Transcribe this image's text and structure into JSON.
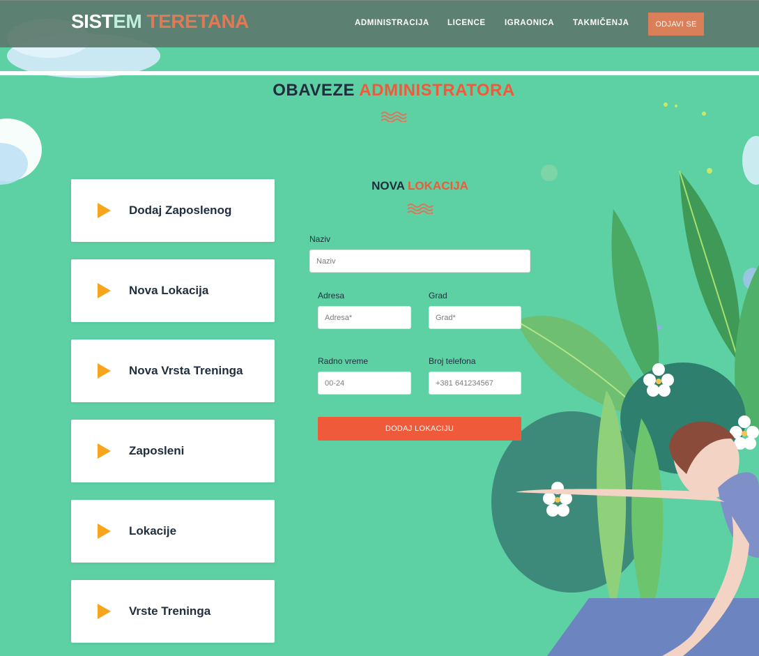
{
  "header": {
    "logo_part1": "SIST",
    "logo_part1b": "EM",
    "logo_part2": "TERETANA",
    "nav": [
      "ADMINISTRACIJA",
      "LICENCE",
      "IGRAONICA",
      "TAKMIČENJA"
    ],
    "logout_label": "ODJAVI SE"
  },
  "page_title": {
    "part1": "OBAVEZE",
    "part2": "ADMINISTRATORA"
  },
  "side_menu": [
    "Dodaj Zaposlenog",
    "Nova Lokacija",
    "Nova Vrsta Treninga",
    "Zaposleni",
    "Lokacije",
    "Vrste Treninga"
  ],
  "form": {
    "title_part1": "NOVA",
    "title_part2": "LOKACIJA",
    "naziv_label": "Naziv",
    "naziv_placeholder": "Naziv",
    "adresa_label": "Adresa",
    "adresa_placeholder": "Adresa*",
    "grad_label": "Grad",
    "grad_placeholder": "Grad*",
    "radno_label": "Radno vreme",
    "radno_placeholder": "00-24",
    "telefon_label": "Broj telefona",
    "telefon_placeholder": "+381 641234567",
    "submit_label": "DODAJ LOKACIJU"
  },
  "colors": {
    "background": "#5dd0a4",
    "accent_orange": "#ef5a3a",
    "play_icon": "#f7a51c",
    "logout_button": "#d9805a"
  },
  "icons": {
    "card_icon": "play-triangle-icon",
    "title_decoration": "wave-icon"
  }
}
